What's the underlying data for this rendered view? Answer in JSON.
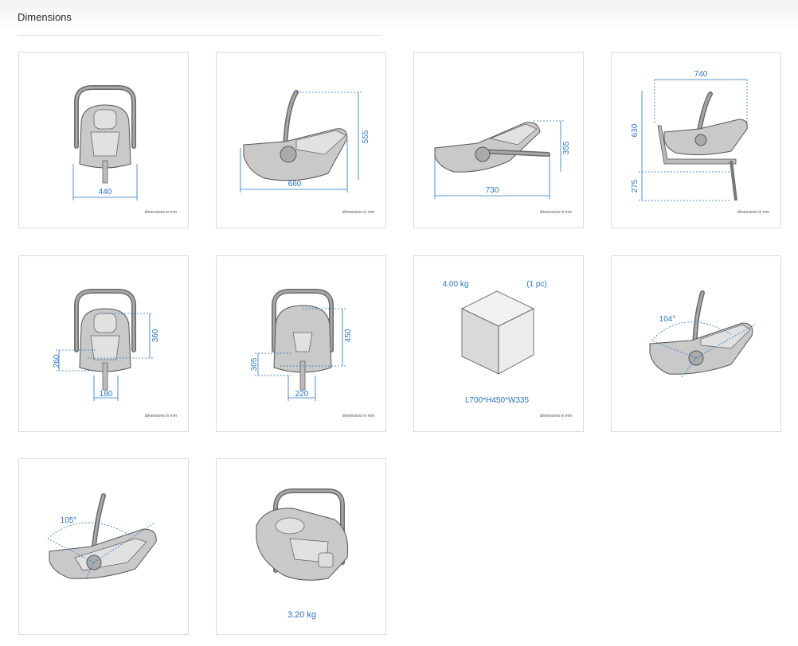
{
  "page": {
    "title": "Dimensions"
  },
  "note_text": "dimensions in mm",
  "colors": {
    "dimension_blue": "#2a74c1",
    "seat_gray": "#c9c9c9",
    "outline": "#555555"
  },
  "cards": {
    "front_width": {
      "width": "440",
      "note": "dimensions in mm"
    },
    "side_length": {
      "height": "555",
      "length": "660",
      "note": "dimensions in mm"
    },
    "side_recline": {
      "height": "355",
      "length": "730",
      "note": "dimensions in mm"
    },
    "with_base": {
      "length": "740",
      "seat_height": "630",
      "base_height": "275",
      "note": "dimensions in mm"
    },
    "inner_small": {
      "height_a": "360",
      "height_b": "260",
      "width": "180",
      "note": "dimensions in mm"
    },
    "inner_large": {
      "height_a": "450",
      "height_b": "305",
      "width": "220",
      "note": "dimensions in mm"
    },
    "package": {
      "weight": "4.00 kg",
      "quantity": "(1 pc)",
      "size": "L700*H450*W335",
      "note": "dimensions in mm"
    },
    "angle_a": {
      "angle": "104°"
    },
    "angle_b": {
      "angle": "105°"
    },
    "weight": {
      "weight": "3.20 kg"
    }
  }
}
